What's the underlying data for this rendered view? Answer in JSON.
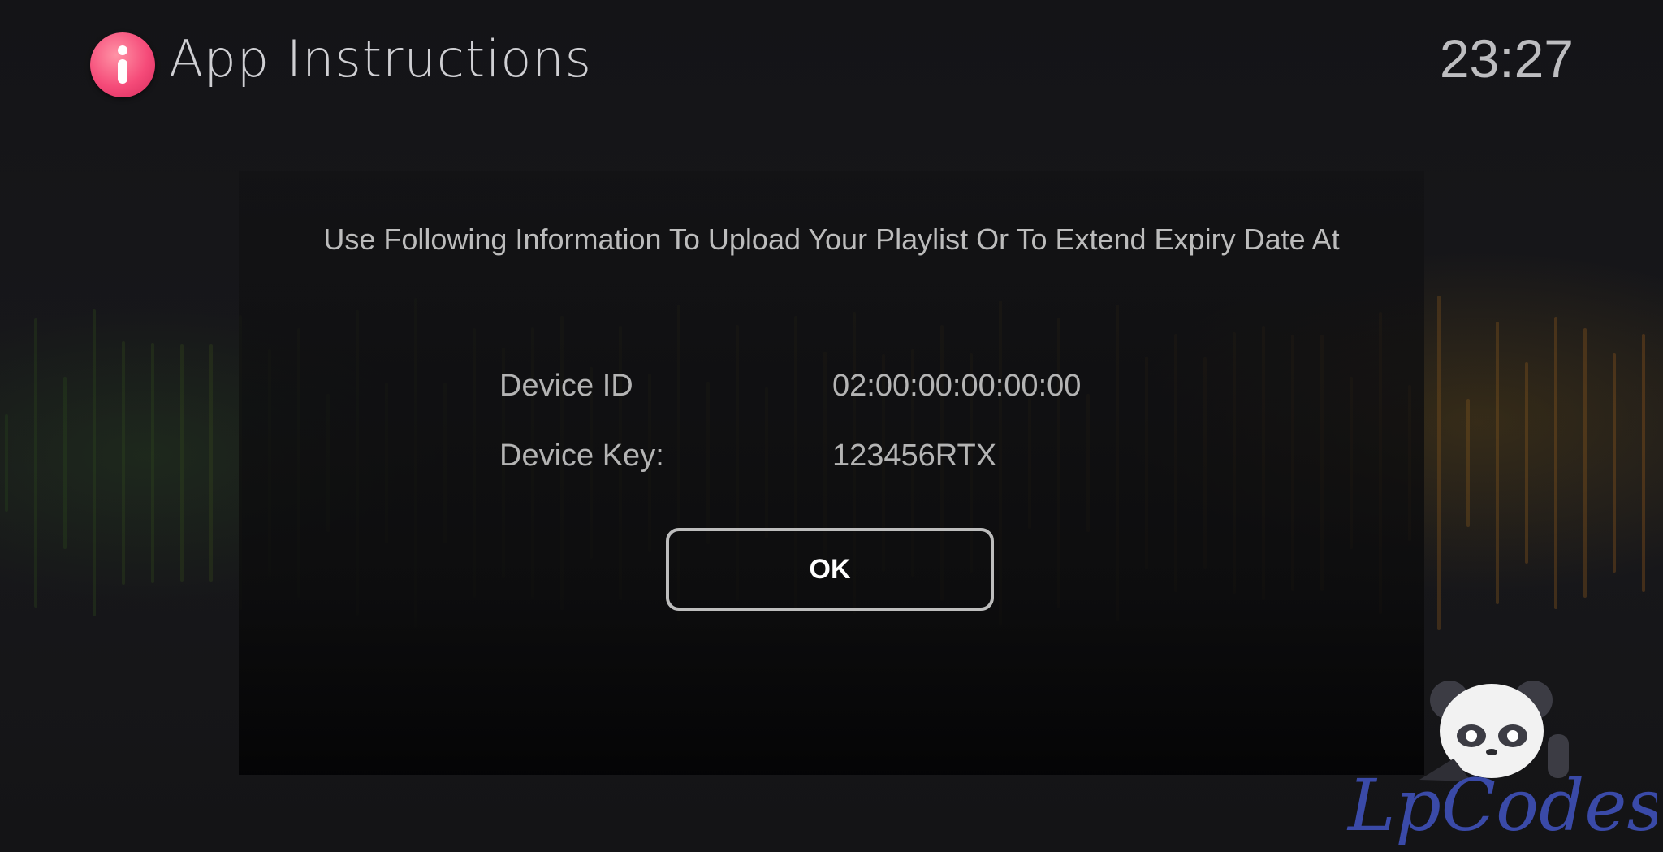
{
  "header": {
    "icon": "info-icon",
    "title": "App Instructions",
    "clock": "23:27"
  },
  "dialog": {
    "message": "Use Following Information To Upload Your Playlist Or To Extend Expiry Date At",
    "rows": [
      {
        "label": "Device ID",
        "value": "02:00:00:00:00:00"
      },
      {
        "label": "Device Key:",
        "value": "123456RTX"
      }
    ],
    "ok_label": "OK"
  },
  "watermark": {
    "text": "LpCodes",
    "icon": "panda-mascot-icon"
  },
  "colors": {
    "background": "#151518",
    "icon_accent": "#f54b79",
    "button_border": "#bdbdbd",
    "watermark_text": "#3a4aa8"
  }
}
